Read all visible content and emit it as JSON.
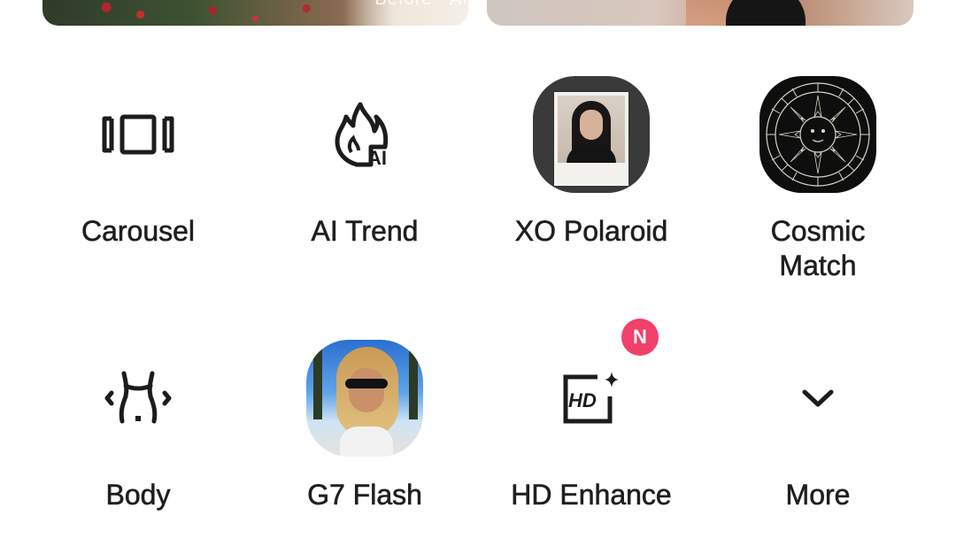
{
  "banners": {
    "left_caption": "Before · AI"
  },
  "features": [
    {
      "id": "carousel",
      "label": "Carousel",
      "icon": "carousel-icon"
    },
    {
      "id": "ai-trend",
      "label": "AI Trend",
      "icon": "ai-flame-icon"
    },
    {
      "id": "xo-polaroid",
      "label": "XO Polaroid",
      "icon": "polaroid-thumbnail"
    },
    {
      "id": "cosmic-match",
      "label": "Cosmic\nMatch",
      "icon": "zodiac-wheel-thumbnail"
    },
    {
      "id": "body",
      "label": "Body",
      "icon": "body-shape-icon"
    },
    {
      "id": "g7-flash",
      "label": "G7 Flash",
      "icon": "flash-portrait-thumbnail"
    },
    {
      "id": "hd-enhance",
      "label": "HD Enhance",
      "icon": "hd-sparkle-icon",
      "badge": "N"
    },
    {
      "id": "more",
      "label": "More",
      "icon": "chevron-down-icon"
    }
  ],
  "colors": {
    "badge": "#f0416a",
    "text": "#1f1f1f",
    "icon": "#1c1c1c"
  }
}
